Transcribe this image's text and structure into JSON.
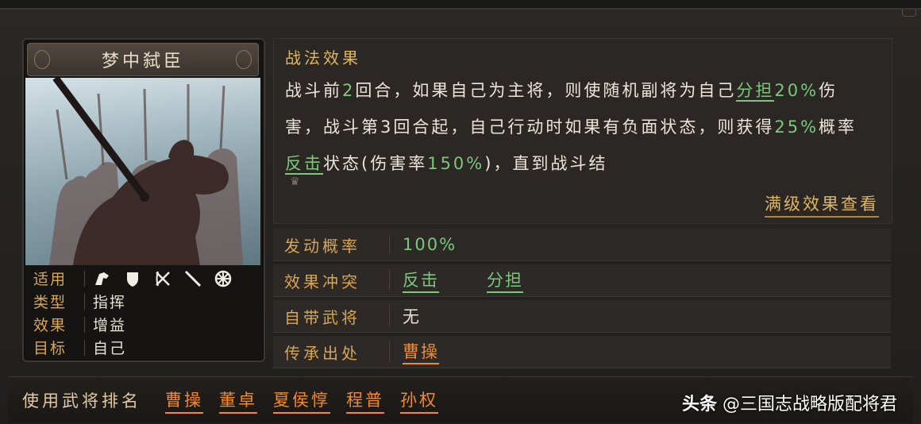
{
  "card": {
    "title": "梦中弑臣",
    "attributes": [
      {
        "label": "适用",
        "icons": [
          "cavalry-icon",
          "shield-icon",
          "bow-icon",
          "spear-icon",
          "wheel-icon"
        ]
      },
      {
        "label": "类型",
        "value": "指挥"
      },
      {
        "label": "效果",
        "value": "增益"
      },
      {
        "label": "目标",
        "value": "自己"
      }
    ]
  },
  "effect": {
    "heading": "战法效果",
    "segments": [
      {
        "text": "战斗前"
      },
      {
        "text": "2",
        "style": "green"
      },
      {
        "text": "回合，如果自己为主将，则使随机副将为自己"
      },
      {
        "text": "分担",
        "style": "green-ul"
      },
      {
        "text": "20%",
        "style": "green"
      },
      {
        "text": "伤害，战斗第3回合起，自己行动时如果有负面状态，则获得"
      },
      {
        "text": "25%",
        "style": "green"
      },
      {
        "text": "概率"
      },
      {
        "text": "反击",
        "style": "green-ul"
      },
      {
        "text": "状态(伤害率"
      },
      {
        "text": "150%",
        "style": "green"
      },
      {
        "text": ")，直到战斗结"
      }
    ],
    "more_marker": "♛",
    "full_level_link": "满级效果查看"
  },
  "info": {
    "rows": [
      {
        "label": "发动概率",
        "values": [
          {
            "text": "100%",
            "style": "green"
          }
        ]
      },
      {
        "label": "效果冲突",
        "values": [
          {
            "text": "反击",
            "style": "green-ul"
          },
          {
            "text": "分担",
            "style": "green-ul"
          }
        ]
      },
      {
        "label": "自带武将",
        "values": [
          {
            "text": "无",
            "style": "plain"
          }
        ]
      },
      {
        "label": "传承出处",
        "values": [
          {
            "text": "曹操",
            "style": "orange"
          }
        ]
      }
    ]
  },
  "ranking": {
    "label": "使用武将排名",
    "names": [
      "曹操",
      "董卓",
      "夏侯惇",
      "程普",
      "孙权"
    ]
  },
  "watermark": {
    "brand": "头条",
    "text": "@三国志战略版配将君"
  },
  "colors": {
    "gold": "#d9a651",
    "green": "#7cc779",
    "orange": "#f08a2c"
  }
}
